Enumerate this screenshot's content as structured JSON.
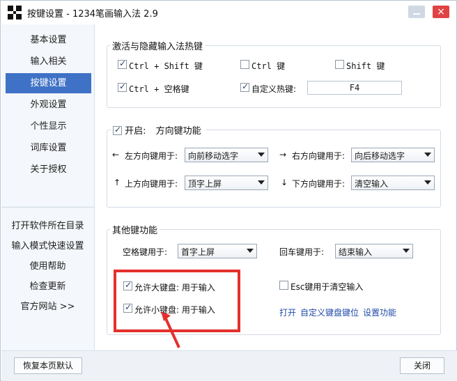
{
  "window": {
    "title": "按键设置 - 1234笔画输入法 2.9",
    "close_glyph": "×"
  },
  "sidebar": {
    "items": [
      {
        "label": "基本设置"
      },
      {
        "label": "输入相关"
      },
      {
        "label": "按键设置"
      },
      {
        "label": "外观设置"
      },
      {
        "label": "个性显示"
      },
      {
        "label": "词库设置"
      },
      {
        "label": "关于授权"
      }
    ],
    "links": [
      {
        "label": "打开软件所在目录"
      },
      {
        "label": "输入模式快速设置"
      },
      {
        "label": "使用帮助"
      },
      {
        "label": "检查更新"
      },
      {
        "label": "官方网站 >>"
      }
    ]
  },
  "hotkeys": {
    "title": "激活与隐藏输入法热键",
    "ctrl_shift": {
      "label": "Ctrl + Shift 键",
      "checked": true
    },
    "ctrl": {
      "label": "Ctrl 键",
      "checked": false
    },
    "shift": {
      "label": "Shift 键",
      "checked": false
    },
    "ctrl_space": {
      "label": "Ctrl + 空格键",
      "checked": true
    },
    "custom": {
      "label": "自定义热键:",
      "checked": true
    },
    "custom_value": "F4"
  },
  "arrows": {
    "enable_label": "开启:",
    "enabled": true,
    "title": "方向键功能",
    "left": {
      "arrow": "←",
      "label": "左方向键用于:",
      "value": "向前移动选字"
    },
    "right": {
      "arrow": "→",
      "label": "右方向键用于:",
      "value": "向后移动选字"
    },
    "up": {
      "arrow": "↑",
      "label": "上方向键用于:",
      "value": "顶字上屏"
    },
    "down": {
      "arrow": "↓",
      "label": "下方向键用于:",
      "value": "清空输入"
    }
  },
  "other": {
    "title": "其他键功能",
    "space": {
      "label": "空格键用于:",
      "value": "首字上屏"
    },
    "enter": {
      "label": "回车键用于:",
      "value": "结束输入"
    },
    "big_keypad": {
      "label": "允许大键盘: 用于输入",
      "checked": true
    },
    "small_keypad": {
      "label": "允许小键盘: 用于输入",
      "checked": true
    },
    "esc": {
      "label": "Esc键用于清空输入",
      "checked": false
    },
    "link_open": "打开",
    "link_custom": "自定义键盘键位",
    "link_settings": "设置功能"
  },
  "footer": {
    "restore_label": "恢复本页默认",
    "close_label": "关闭"
  },
  "colors": {
    "accent": "#3f72c7",
    "highlight": "#e3302c",
    "link": "#1f4aa8"
  }
}
